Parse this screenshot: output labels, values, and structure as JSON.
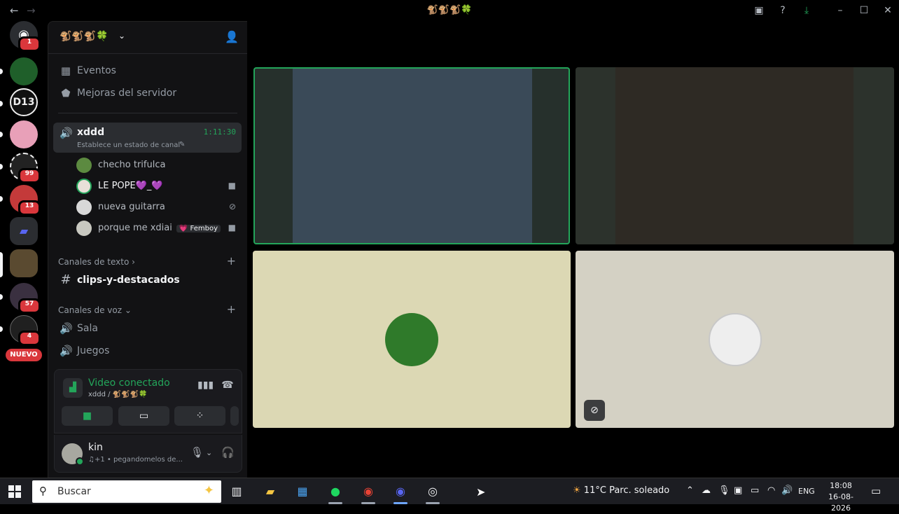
{
  "window": {
    "title": "🐒🐒🐒🍀",
    "back_icon": "arrow-left",
    "forward_icon": "arrow-right"
  },
  "rail": {
    "badges": [
      "1",
      "99",
      "13",
      "57",
      "4"
    ],
    "new_label": "NUEVO"
  },
  "server": {
    "name": "🐒🐒🐒🍀",
    "items": [
      {
        "label": "Eventos",
        "icon": "calendar"
      },
      {
        "label": "Mejoras del servidor",
        "icon": "boost"
      }
    ]
  },
  "active_channel": {
    "name": "xddd",
    "status": "Establece un estado de canal",
    "timer": "1:11:30"
  },
  "members": [
    {
      "name": "checho trifulca",
      "status_icon": "",
      "tag": ""
    },
    {
      "name": "LE POPE💜_💜",
      "status_icon": "video-camera",
      "tag": ""
    },
    {
      "name": "nueva guitarra",
      "status_icon": "muted-mic",
      "tag": ""
    },
    {
      "name": "porque me xdiai",
      "status_icon": "video-camera",
      "tag": "💗 Femboy"
    }
  ],
  "text_category": {
    "label": "Canales de texto",
    "channels": [
      {
        "name": "clips-y-destacados"
      }
    ]
  },
  "voice_category": {
    "label": "Canales de voz",
    "channels": [
      {
        "name": "Sala"
      },
      {
        "name": "Juegos"
      }
    ]
  },
  "voice_panel": {
    "title": "Video conectado",
    "subtitle": "xddd / 🐒🐒🐒🍀"
  },
  "user": {
    "name": "kin",
    "status": "♫+1 • pegandomelos de..."
  },
  "taskbar": {
    "search_placeholder": "Buscar",
    "weather_temp": "11°C",
    "weather_desc": "Parc. soleado",
    "language": "ENG",
    "time": "18:08",
    "date": "16-08-2026"
  },
  "colors": {
    "accent_green": "#23a55a",
    "badge_red": "#da373c",
    "bg": "#121214"
  }
}
